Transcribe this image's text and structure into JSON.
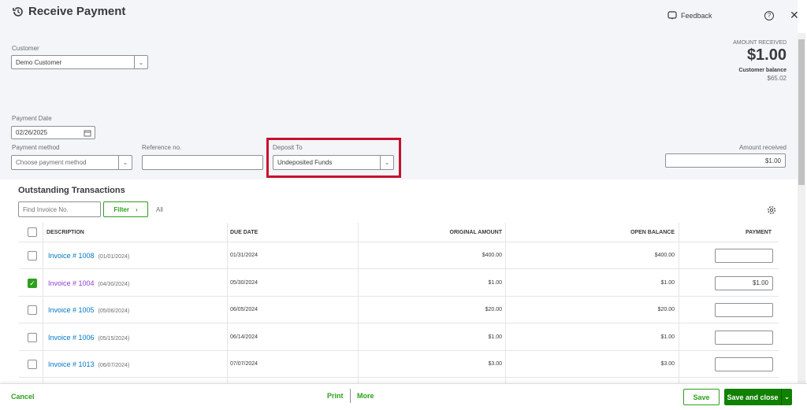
{
  "header": {
    "title": "Receive Payment",
    "feedback": "Feedback"
  },
  "customer": {
    "label": "Customer",
    "value": "Demo Customer"
  },
  "summary": {
    "amount_received_label": "AMOUNT RECEIVED",
    "amount_received": "$1.00",
    "balance_label": "Customer balance",
    "balance": "$65.02"
  },
  "payment_date": {
    "label": "Payment Date",
    "value": "02/26/2025"
  },
  "payment_method": {
    "label": "Payment method",
    "placeholder": "Choose payment method"
  },
  "reference": {
    "label": "Reference no.",
    "value": ""
  },
  "deposit_to": {
    "label": "Deposit To",
    "value": "Undeposited Funds",
    "highlight_color": "#c8102e"
  },
  "amount_received_field": {
    "label": "Amount received",
    "value": "$1.00"
  },
  "outstanding": {
    "title": "Outstanding Transactions",
    "find_placeholder": "Find Invoice No.",
    "filter_label": "Filter",
    "all_label": "All",
    "columns": [
      "DESCRIPTION",
      "DUE DATE",
      "ORIGINAL AMOUNT",
      "OPEN BALANCE",
      "PAYMENT"
    ],
    "rows": [
      {
        "invoice": "Invoice # 1008",
        "date": "(01/01/2024)",
        "due": "01/31/2024",
        "original": "$400.00",
        "open": "$400.00",
        "payment": "",
        "checked": false
      },
      {
        "invoice": "Invoice # 1004",
        "date": "(04/30/2024)",
        "due": "05/30/2024",
        "original": "$1.00",
        "open": "$1.00",
        "payment": "$1.00",
        "checked": true
      },
      {
        "invoice": "Invoice # 1005",
        "date": "(05/06/2024)",
        "due": "06/05/2024",
        "original": "$20.00",
        "open": "$20.00",
        "payment": "",
        "checked": false
      },
      {
        "invoice": "Invoice # 1006",
        "date": "(05/15/2024)",
        "due": "06/14/2024",
        "original": "$1.00",
        "open": "$1.00",
        "payment": "",
        "checked": false
      },
      {
        "invoice": "Invoice # 1013",
        "date": "(06/07/2024)",
        "due": "07/07/2024",
        "original": "$3.00",
        "open": "$3.00",
        "payment": "",
        "checked": false
      }
    ]
  },
  "footer": {
    "cancel": "Cancel",
    "print": "Print",
    "more": "More",
    "save": "Save",
    "save_close": "Save and close"
  },
  "colors": {
    "accent": "#2ca01c",
    "primary_button": "#108000",
    "link": "#0077c5",
    "visited_link": "#8d3dd6"
  }
}
